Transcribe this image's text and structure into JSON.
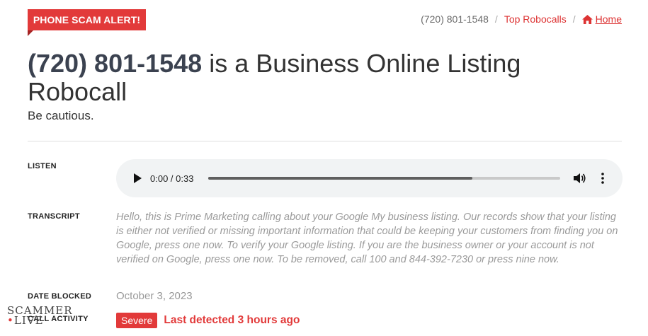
{
  "header": {
    "badge": "PHONE SCAM ALERT!",
    "breadcrumb": {
      "current": "(720) 801-1548",
      "separator": "/",
      "top_robocalls": "Top Robocalls",
      "home": "Home"
    }
  },
  "title": {
    "number": "(720) 801-1548",
    "rest": " is a Business Online Listing Robocall"
  },
  "subtitle": "Be cautious.",
  "sections": {
    "listen_label": "LISTEN",
    "transcript_label": "TRANSCRIPT",
    "date_label": "DATE BLOCKED",
    "activity_label": "CALL ACTIVITY"
  },
  "player": {
    "time": "0:00 / 0:33",
    "progress": 0.75
  },
  "transcript": "Hello, this is Prime Marketing calling about your Google My business listing. Our records show that your listing is either not verified or missing important information that could be keeping your customers from finding you on Google, press one now. To verify your Google listing. If you are the business owner or your account is not verified on Google, press one now. To be removed, call 100 and 844-392-7230 or press nine now.",
  "date_blocked": "October 3, 2023",
  "activity": {
    "severity": "Severe",
    "last_detected": "Last detected 3 hours ago"
  },
  "watermark": {
    "line1": "SCAMMER",
    "line2": "LIVE"
  },
  "colors": {
    "accent": "#e23a3a",
    "title": "#3b4250"
  },
  "icons": [
    "play-icon",
    "volume-icon",
    "more-vert-icon",
    "home-icon"
  ]
}
